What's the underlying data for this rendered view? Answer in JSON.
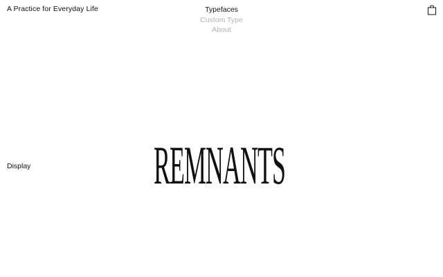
{
  "header": {
    "brand": "A Practice for Everyday Life",
    "nav": {
      "typefaces": "Typefaces",
      "custom_type": "Custom Type",
      "about": "About"
    },
    "cart_icon": "shopping-bag-icon"
  },
  "main": {
    "category": "Display",
    "specimen": "REMNANTS"
  },
  "colors": {
    "text": "#111111",
    "muted": "#b3b3b3",
    "background": "#ffffff"
  }
}
